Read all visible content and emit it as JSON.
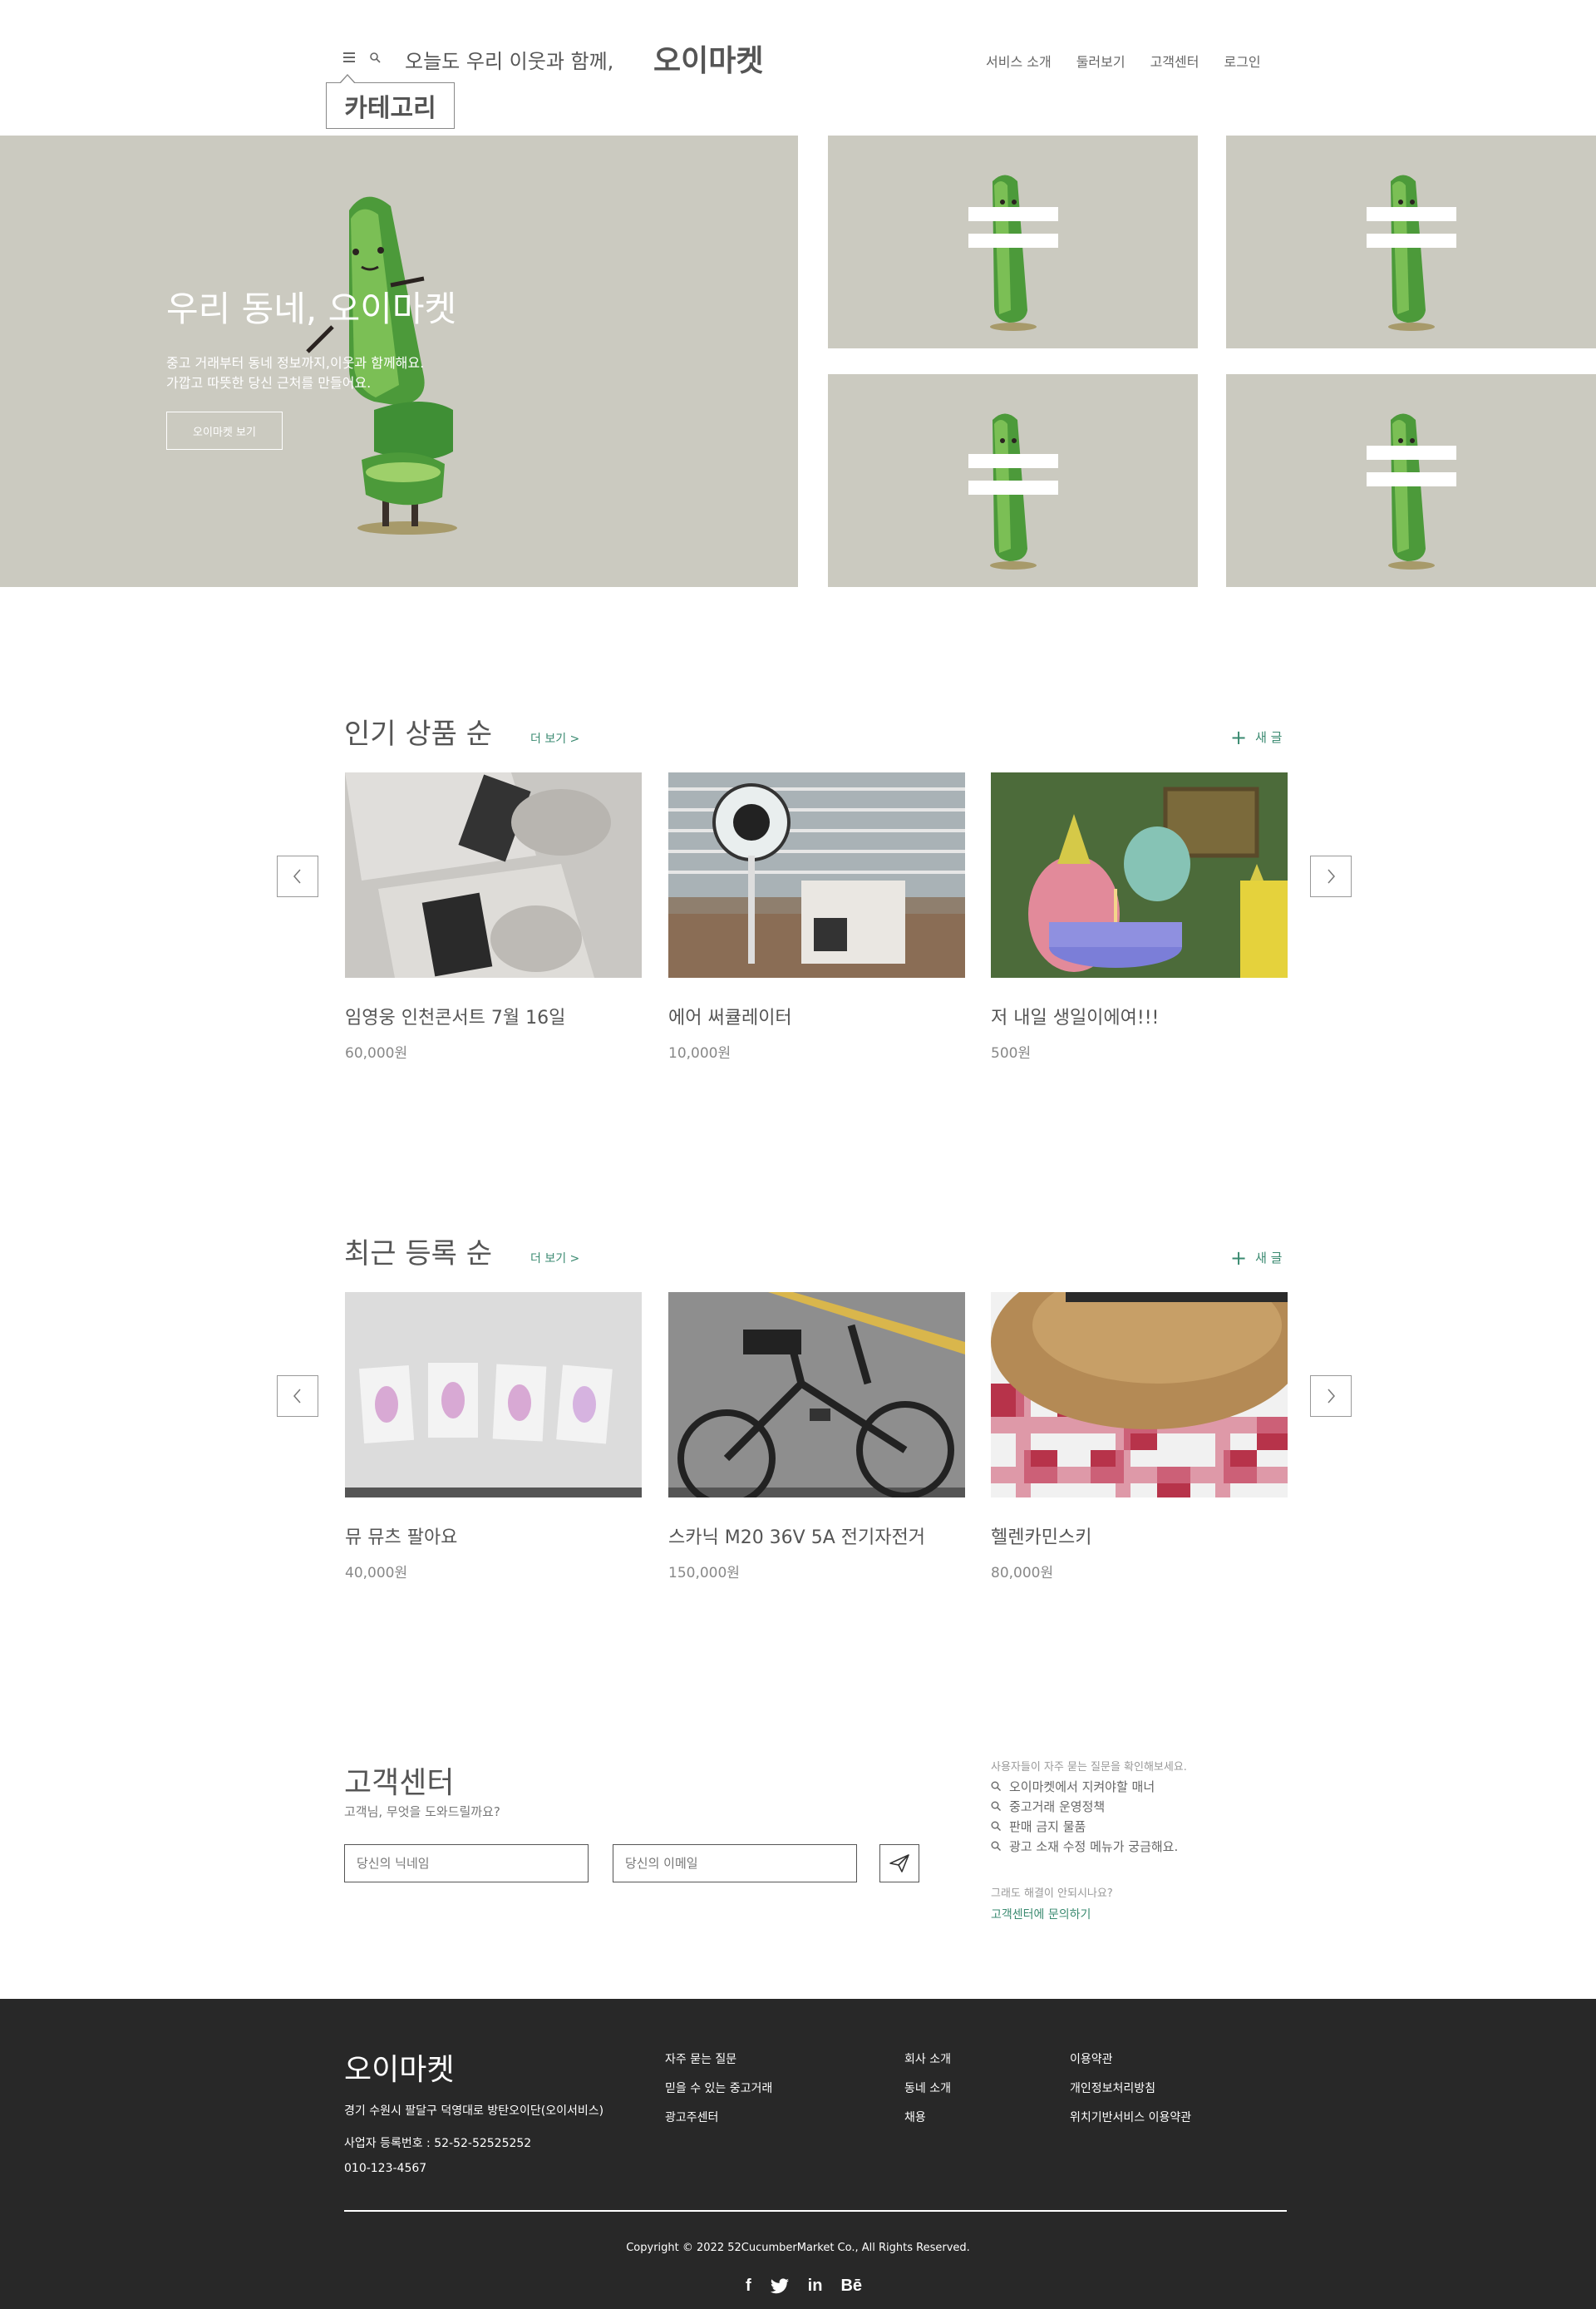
{
  "header": {
    "tagline": "오늘도 우리 이웃과 함께,",
    "brand": "오이마켓",
    "category_label": "카테고리",
    "nav": [
      "서비스 소개",
      "둘러보기",
      "고객센터",
      "로그인"
    ]
  },
  "hero": {
    "title": "우리 동네, 오이마켓",
    "desc_line1": "중고 거래부터 동네 정보까지,이웃과 함께해요.",
    "desc_line2": "가깝고 따뜻한 당신 근처를 만들어요.",
    "button_label": "오이마켓 보기"
  },
  "popular": {
    "title": "인기 상품 순",
    "more_label": "더 보기 >",
    "new_post_label": "새 글",
    "items": [
      {
        "name": "임영웅 인천콘서트 7월 16일",
        "price": "60,000원"
      },
      {
        "name": "에어 써큘레이터",
        "price": "10,000원"
      },
      {
        "name": "저 내일 생일이에여!!!",
        "price": "500원"
      }
    ]
  },
  "recent": {
    "title": "최근 등록 순",
    "more_label": "더 보기 >",
    "new_post_label": "새 글",
    "items": [
      {
        "name": "뮤 뮤츠 팔아요",
        "price": "40,000원"
      },
      {
        "name": "스카닉 M20  36V 5A 전기자전거",
        "price": "150,000원"
      },
      {
        "name": "헬렌카민스키",
        "price": "80,000원"
      }
    ]
  },
  "customer_center": {
    "title": "고객센터",
    "subtitle": "고객님, 무엇을 도와드릴까요?",
    "nickname_placeholder": "당신의 닉네임",
    "email_placeholder": "당신의 이메일",
    "faq_intro": "사용자들이 자주 묻는 질문을 확인해보세요.",
    "faq": [
      "오이마켓에서 지켜야할 매너",
      "중고거래 운영정책",
      "판매 금지 물품",
      "광고 소재 수정 메뉴가 궁금해요."
    ],
    "still_label": "그래도 해결이 안되시나요?",
    "contact_label": "고객센터에 문의하기"
  },
  "footer": {
    "brand": "오이마켓",
    "address": "경기 수원시 팔달구 덕영대로 방탄오이단(오이서비스)",
    "biz_no": "사업자 등록번호 : 52-52-52525252",
    "phone": "010-123-4567",
    "col1": [
      "자주 묻는 질문",
      "믿을 수 있는 중고거래",
      "광고주센터"
    ],
    "col2": [
      "회사 소개",
      "동네 소개",
      "채용"
    ],
    "col3": [
      "이용약관",
      "개인정보처리방침",
      "위치기반서비스 이용약관"
    ],
    "copyright": "Copyright © 2022 52CucumberMarket Co., All Rights Reserved.",
    "social": [
      "f",
      "twitter-icon",
      "in",
      "Bē"
    ]
  },
  "colors": {
    "accent": "#3a8a70",
    "hero_bg": "#cbcac0",
    "footer_bg": "#282828"
  }
}
